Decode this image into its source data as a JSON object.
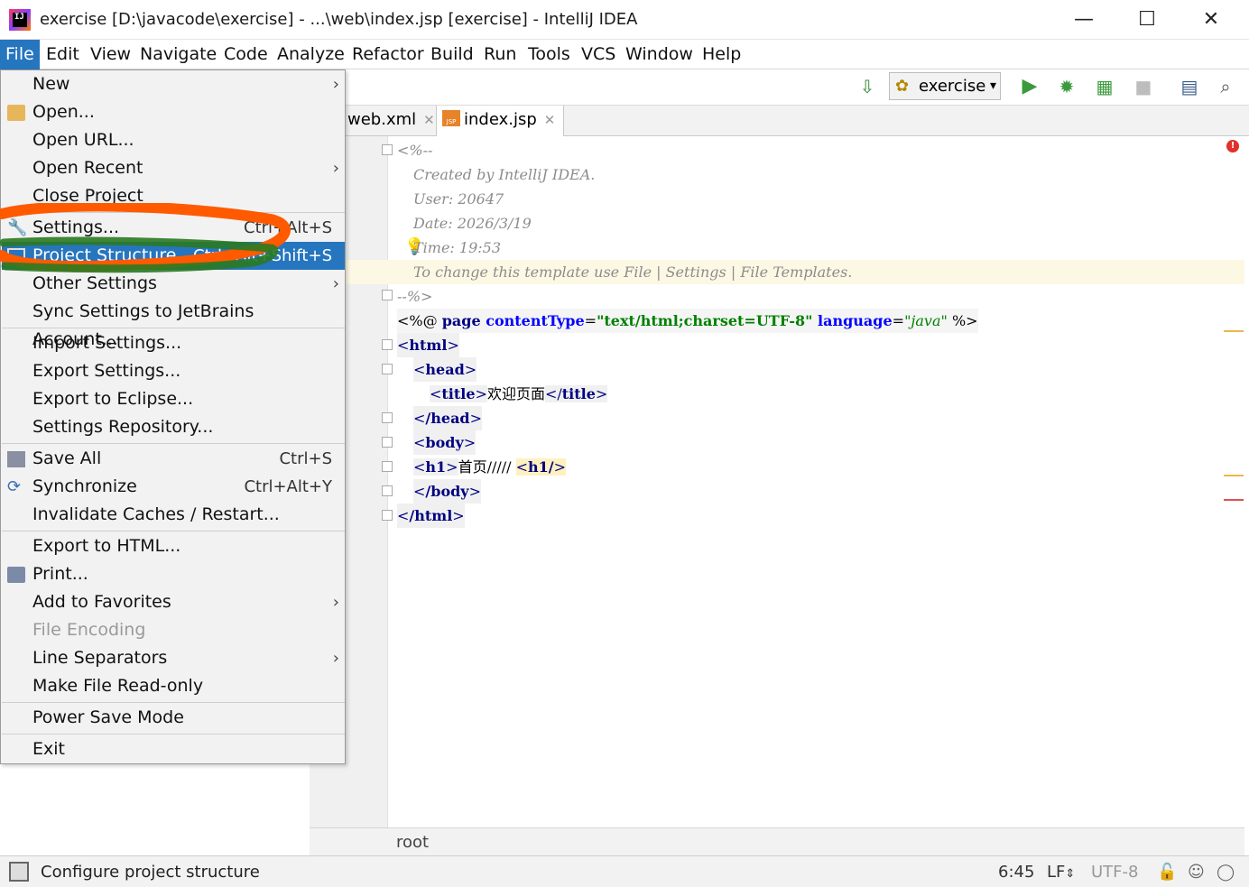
{
  "window": {
    "title": "exercise [D:\\javacode\\exercise] - ...\\web\\index.jsp [exercise] - IntelliJ IDEA",
    "minimize": "—",
    "maximize": "☐",
    "close": "✕"
  },
  "menubar": {
    "items": [
      "File",
      "Edit",
      "View",
      "Navigate",
      "Code",
      "Analyze",
      "Refactor",
      "Build",
      "Run",
      "Tools",
      "VCS",
      "Window",
      "Help"
    ],
    "active": "File"
  },
  "toolbar": {
    "run_config": "exercise"
  },
  "tabs": [
    {
      "label": "web.xml",
      "close": "✕"
    },
    {
      "label": "index.jsp",
      "close": "✕",
      "badge": "JSP"
    }
  ],
  "file_menu": {
    "items": [
      {
        "label": "New",
        "submenu": true
      },
      {
        "label": "Open...",
        "icon": "folder-icon"
      },
      {
        "label": "Open URL..."
      },
      {
        "label": "Open Recent",
        "submenu": true
      },
      {
        "label": "Close Project"
      },
      {
        "label": "Settings...",
        "shortcut": "Ctrl+Alt+S",
        "icon": "wrench-icon"
      },
      {
        "label": "Project Structure...",
        "shortcut": "Ctrl+Alt+Shift+S",
        "icon": "project-structure-icon",
        "selected": true
      },
      {
        "label": "Other Settings",
        "submenu": true
      },
      {
        "label": "Sync Settings to JetBrains Account..."
      },
      {
        "label": "Import Settings..."
      },
      {
        "label": "Export Settings..."
      },
      {
        "label": "Export to Eclipse..."
      },
      {
        "label": "Settings Repository..."
      },
      {
        "label": "Save All",
        "shortcut": "Ctrl+S",
        "icon": "save-icon"
      },
      {
        "label": "Synchronize",
        "shortcut": "Ctrl+Alt+Y",
        "icon": "sync-icon"
      },
      {
        "label": "Invalidate Caches / Restart..."
      },
      {
        "label": "Export to HTML..."
      },
      {
        "label": "Print...",
        "icon": "print-icon"
      },
      {
        "label": "Add to Favorites",
        "submenu": true
      },
      {
        "label": "File Encoding",
        "disabled": true
      },
      {
        "label": "Line Separators",
        "submenu": true
      },
      {
        "label": "Make File Read-only"
      },
      {
        "label": "Power Save Mode"
      },
      {
        "label": "Exit"
      }
    ],
    "submenu_arrow": "›"
  },
  "editor": {
    "lines": {
      "l1": "<%--",
      "l2": "Created by IntelliJ IDEA.",
      "l3": "User: 20647",
      "l4": "Date: 2026/3/19",
      "l5": "Time: 19:53",
      "l6": "To change this template use File | Settings | File Templates.",
      "l7": "--%>",
      "l8_open": "<%@ ",
      "l8_page": "page ",
      "l8_attr1": "contentType",
      "l8_eq1": "=",
      "l8_val1": "\"text/html;charset=UTF-8\"",
      "l8_attr2": " language",
      "l8_eq2": "=",
      "l8_val2": "\"java\"",
      "l8_close": " %>",
      "l9": "html",
      "l10": "head",
      "l11_tag": "title",
      "l11_text": "欢迎页面",
      "l12": "/head",
      "l13": "body",
      "l14_tag": "h1",
      "l14_text": "首页///// ",
      "l14_close": "h1/",
      "l15": "/body",
      "l16": "/html"
    },
    "breadcrumb": "root"
  },
  "statusbar": {
    "message": "Configure project structure",
    "position": "6:45",
    "line_sep": "LF",
    "encoding": "UTF-8"
  },
  "colors": {
    "menu_selected": "#2675bf",
    "scribble_orange": "#ff5a00",
    "scribble_green": "#2a7a22"
  }
}
